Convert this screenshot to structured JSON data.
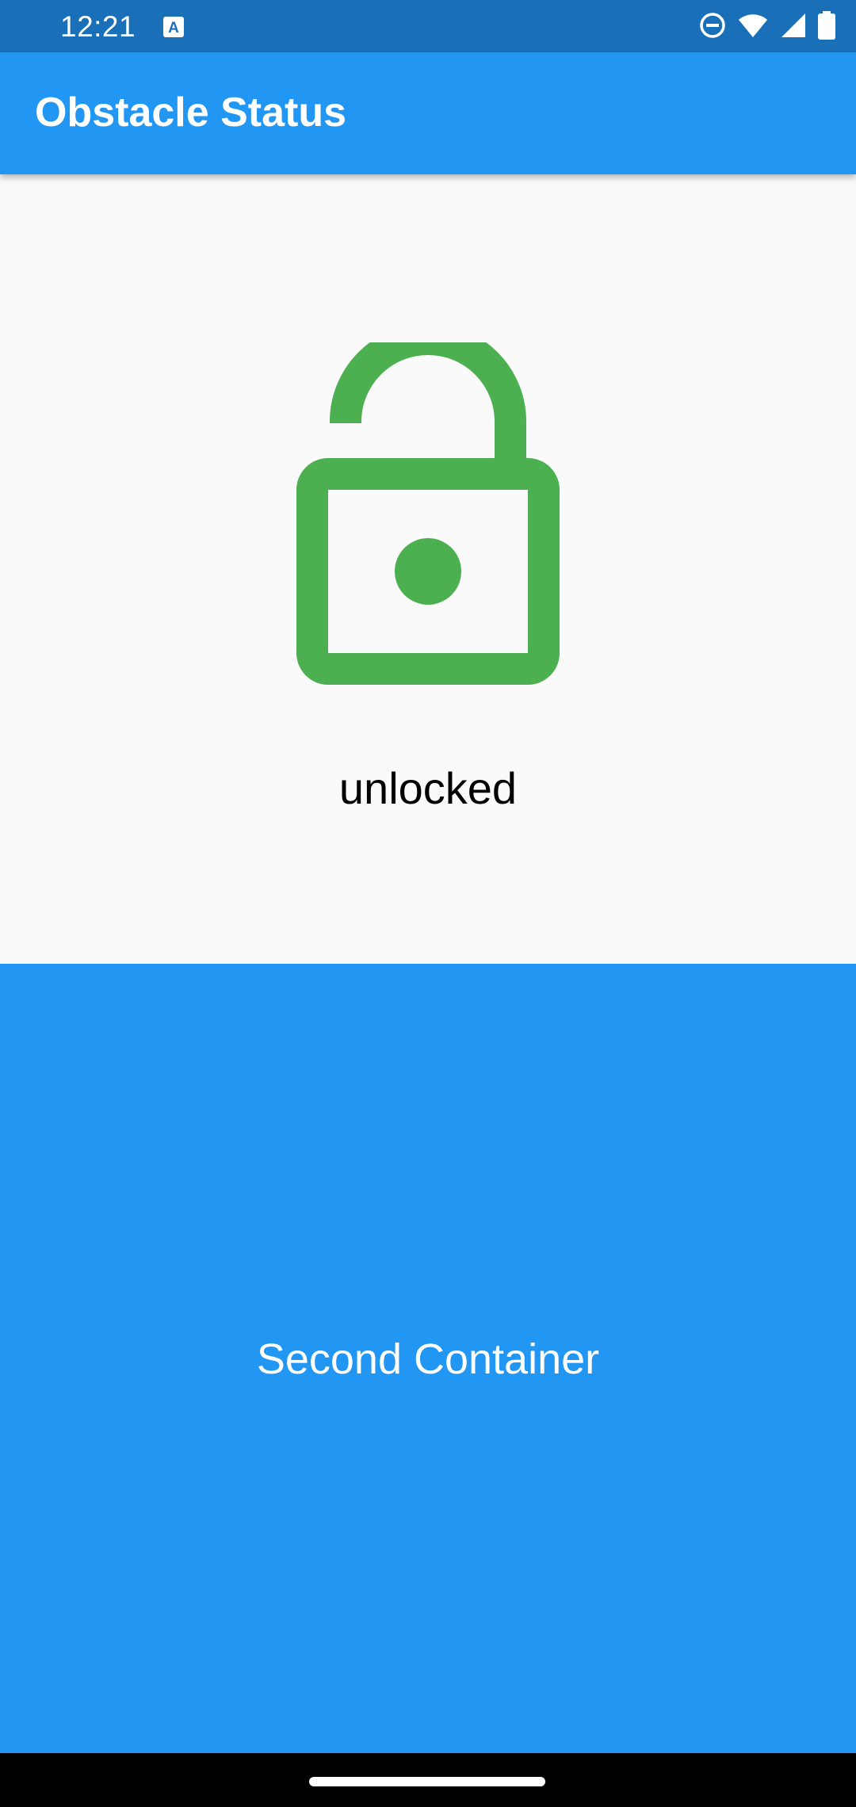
{
  "status_bar": {
    "time": "12:21",
    "icons": [
      "accessibility-a-icon",
      "do-not-disturb-icon",
      "wifi-icon",
      "cell-signal-icon",
      "battery-icon"
    ]
  },
  "app_bar": {
    "title": "Obstacle Status",
    "color": "#2196f3"
  },
  "lock_panel": {
    "icon": "lock-open-icon",
    "icon_color": "#4caf50",
    "status_text": "unlocked"
  },
  "second_panel": {
    "label": "Second Container",
    "color": "#2196f3"
  },
  "nav_bar": {
    "handle": "home-handle"
  }
}
